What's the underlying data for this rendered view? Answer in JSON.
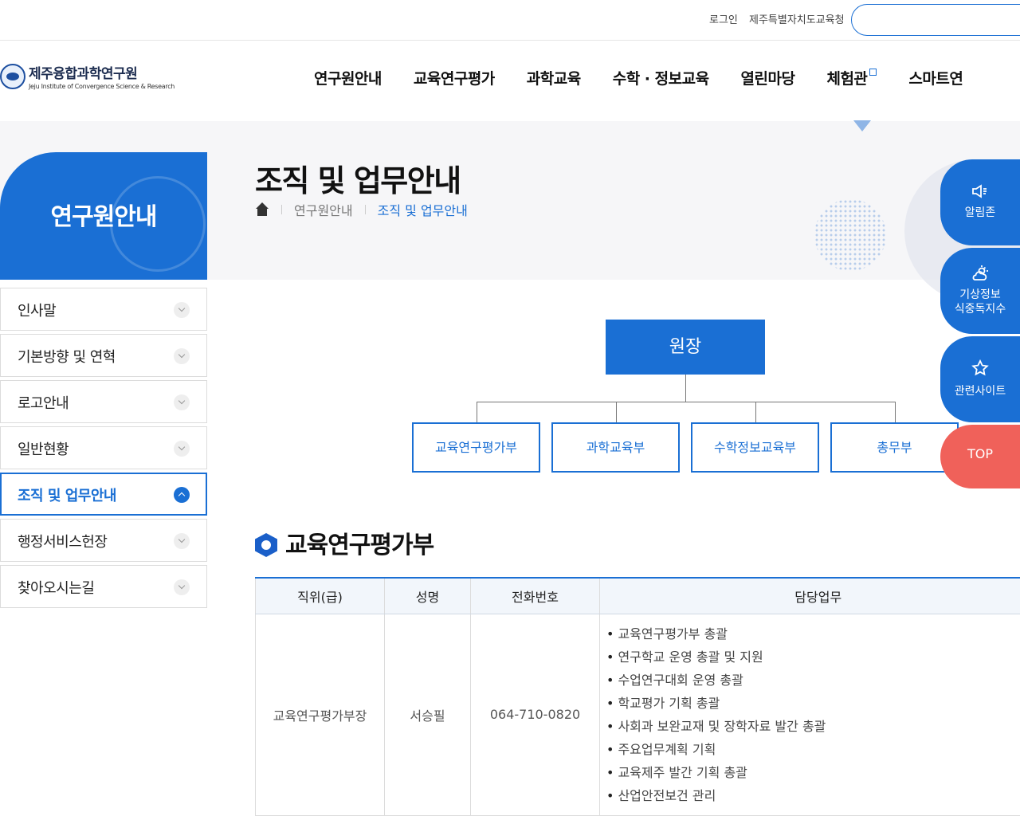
{
  "topbar": {
    "login": "로그인",
    "office": "제주특별자치도교육청"
  },
  "logo": {
    "ko": "제주융합과학연구원",
    "en": "Jeju Institute of Convergence Science & Research"
  },
  "gnb": [
    "연구원안내",
    "교육연구평가",
    "과학교육",
    "수학 · 정보교육",
    "열린마당",
    "체험관",
    "스마트연"
  ],
  "lnb": {
    "title": "연구원안내",
    "items": [
      "인사말",
      "기본방향 및 연혁",
      "로고안내",
      "일반현황",
      "조직 및 업무안내",
      "행정서비스헌장",
      "찾아오시는길"
    ],
    "active_index": 4
  },
  "page": {
    "title": "조직 및 업무안내",
    "breadcrumb": [
      "연구원안내",
      "조직 및 업무안내"
    ]
  },
  "org": {
    "head": "원장",
    "departments": [
      "교육연구평가부",
      "과학교육부",
      "수학정보교육부",
      "총무부"
    ]
  },
  "section": {
    "title": "교육연구평가부",
    "columns": [
      "직위(급)",
      "성명",
      "전화번호",
      "담당업무"
    ],
    "rows": [
      {
        "position": "교육연구평가부장",
        "name": "서승필",
        "phone": "064-710-0820",
        "duties": [
          "교육연구평가부 총괄",
          "연구학교 운영 총괄 및 지원",
          "수업연구대회 운영 총괄",
          "학교평가 기획 총괄",
          "사회과 보완교재 및 장학자료 발간 총괄",
          "주요업무계획 기획",
          "교육제주 발간 기획 총괄",
          "산업안전보건 관리"
        ]
      }
    ]
  },
  "quick": {
    "notice": "알림존",
    "weather_1": "기상정보",
    "weather_2": "식중독지수",
    "sites": "관련사이트",
    "top": "TOP"
  },
  "colors": {
    "primary": "#1a6fd4",
    "top_button": "#f0615a"
  }
}
